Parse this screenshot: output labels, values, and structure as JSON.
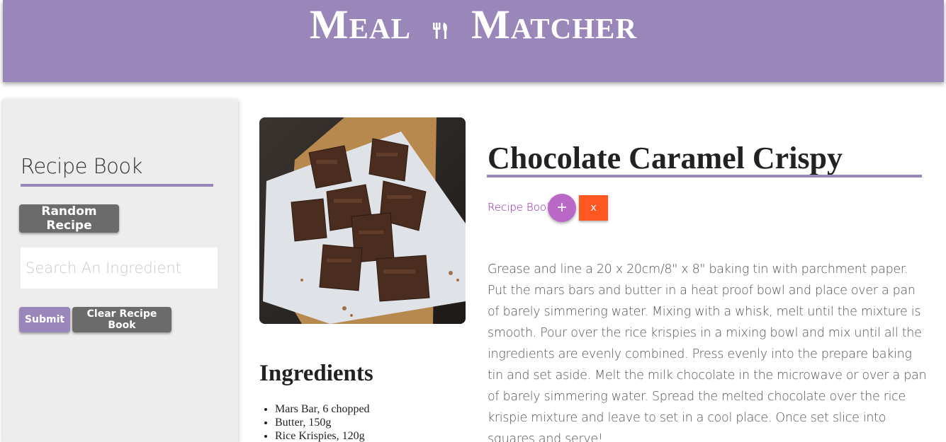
{
  "header": {
    "logo_left": "Meal",
    "logo_right": "Matcher",
    "logo_icon": "fork-knife-icon",
    "bg_color": "#9a87b9"
  },
  "sidebar": {
    "title": "Recipe Book",
    "random_label": "Random Recipe",
    "search_placeholder": "Search An Ingredient",
    "submit_label": "Submit",
    "clear_label": "Clear Recipe Book"
  },
  "recipe": {
    "title": "Chocolate Caramel Crispy",
    "book_link": "Recipe Book",
    "add_label": "+",
    "remove_label": "x",
    "instructions": "Grease and line a 20 x 20cm/8\" x 8\" baking tin with parchment paper. Put the mars bars and butter in a heat proof bowl and place over a pan of barely simmering water. Mixing with a whisk, melt until the mixture is smooth. Pour over the rice krispies in a mixing bowl and mix until all the ingredients are evenly combined. Press evenly into the prepare baking tin and set aside. Melt the milk chocolate in the microwave or over a pan of barely simmering water. Spread the melted chocolate over the rice krispie mixture and leave to set in a cool place. Once set slice into squares and serve!",
    "ingredients_title": "Ingredients",
    "ingredients": [
      "Mars Bar, 6 chopped",
      "Butter, 150g",
      "Rice Krispies, 120g"
    ]
  },
  "colors": {
    "accent": "#9a87b9",
    "add_button": "#ba68c8",
    "remove_button": "#ff5722",
    "link": "#8e24aa"
  }
}
